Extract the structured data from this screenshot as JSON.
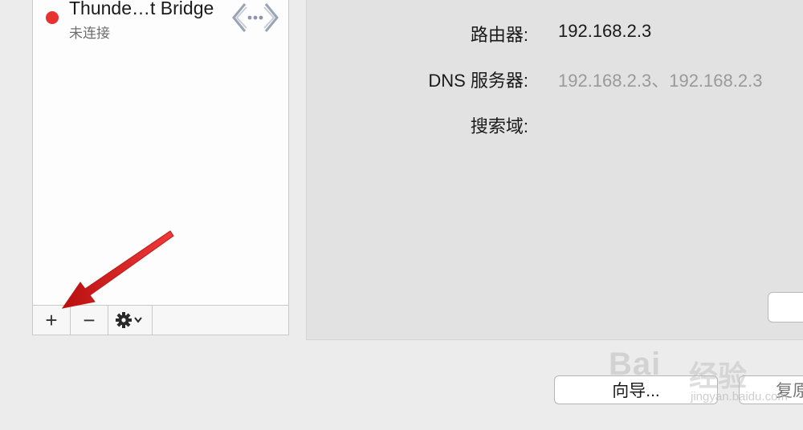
{
  "service_list": {
    "items": [
      {
        "name": "Thunde…t Bridge",
        "status": "未连接",
        "status_color": "#e8322f",
        "icon": "network-bridge-icon"
      }
    ],
    "toolbar": {
      "add_label": "+",
      "remove_label": "−",
      "gear_label": "⚙︎⌄"
    }
  },
  "details": {
    "router_label": "路由器:",
    "router_value": "192.168.2.3",
    "dns_label": "DNS 服务器:",
    "dns_value": "192.168.2.3、192.168.2.3",
    "search_domain_label": "搜索域:"
  },
  "buttons": {
    "assist_label": "向导...",
    "revert_label": "复原"
  },
  "watermark": {
    "brand": "Bai",
    "suffix": "经验",
    "url": "jingyan.baidu.com"
  },
  "annotation": {
    "arrow_color": "#e21d1d",
    "arrow_icon": "red-arrow-icon"
  }
}
